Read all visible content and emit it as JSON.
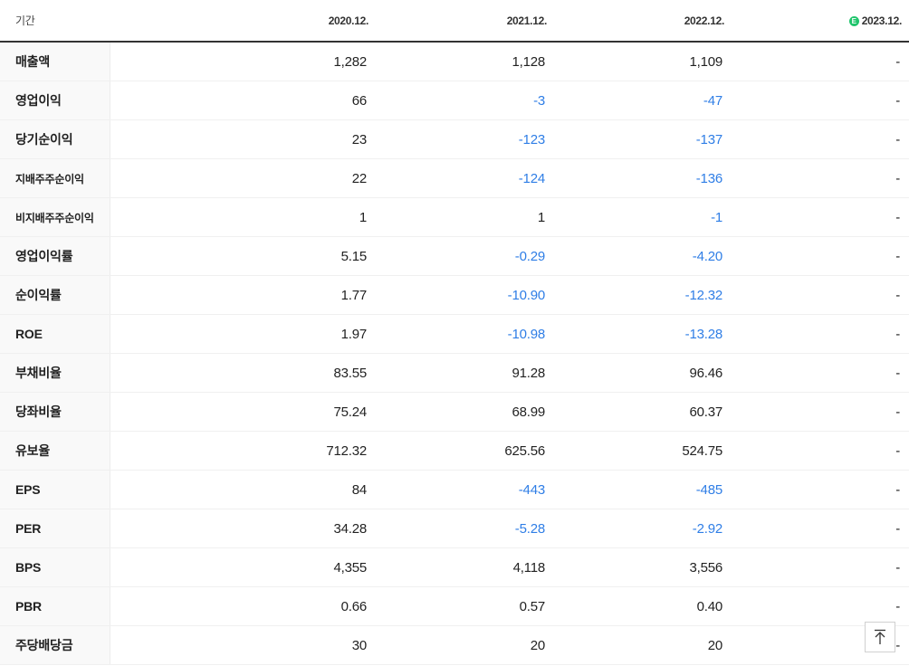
{
  "header": {
    "period_label": "기간",
    "periods": [
      "2020.12.",
      "2021.12.",
      "2022.12.",
      "2023.12."
    ],
    "estimate_icon": "E"
  },
  "rows": [
    {
      "label": "매출액",
      "values": [
        "1,282",
        "1,128",
        "1,109",
        "-"
      ]
    },
    {
      "label": "영업이익",
      "values": [
        "66",
        "-3",
        "-47",
        "-"
      ]
    },
    {
      "label": "당기순이익",
      "values": [
        "23",
        "-123",
        "-137",
        "-"
      ]
    },
    {
      "label": "지배주주순이익",
      "values": [
        "22",
        "-124",
        "-136",
        "-"
      ]
    },
    {
      "label": "비지배주주순이익",
      "values": [
        "1",
        "1",
        "-1",
        "-"
      ]
    },
    {
      "label": "영업이익률",
      "values": [
        "5.15",
        "-0.29",
        "-4.20",
        "-"
      ]
    },
    {
      "label": "순이익률",
      "values": [
        "1.77",
        "-10.90",
        "-12.32",
        "-"
      ]
    },
    {
      "label": "ROE",
      "values": [
        "1.97",
        "-10.98",
        "-13.28",
        "-"
      ]
    },
    {
      "label": "부채비율",
      "values": [
        "83.55",
        "91.28",
        "96.46",
        "-"
      ]
    },
    {
      "label": "당좌비율",
      "values": [
        "75.24",
        "68.99",
        "60.37",
        "-"
      ]
    },
    {
      "label": "유보율",
      "values": [
        "712.32",
        "625.56",
        "524.75",
        "-"
      ]
    },
    {
      "label": "EPS",
      "values": [
        "84",
        "-443",
        "-485",
        "-"
      ]
    },
    {
      "label": "PER",
      "values": [
        "34.28",
        "-5.28",
        "-2.92",
        "-"
      ]
    },
    {
      "label": "BPS",
      "values": [
        "4,355",
        "4,118",
        "3,556",
        "-"
      ]
    },
    {
      "label": "PBR",
      "values": [
        "0.66",
        "0.57",
        "0.40",
        "-"
      ]
    },
    {
      "label": "주당배당금",
      "values": [
        "30",
        "20",
        "20",
        "-"
      ]
    }
  ],
  "colors": {
    "negative": "#2f7ee6",
    "estimate": "#20c56c"
  },
  "scroll_top_icon": "arrow-up-to-top-icon"
}
